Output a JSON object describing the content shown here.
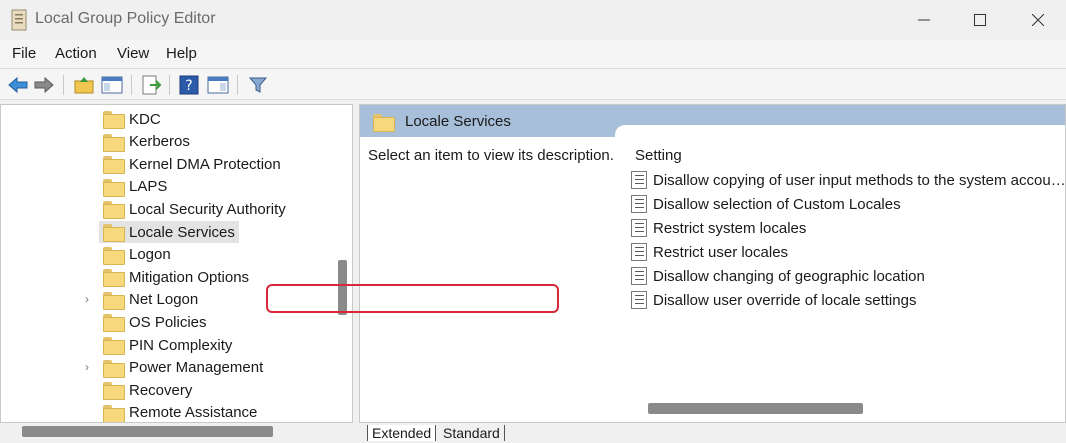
{
  "window": {
    "title": "Local Group Policy Editor",
    "minimize": "—",
    "maximize": "☐",
    "close": "✕"
  },
  "menu": [
    "File",
    "Action",
    "View",
    "Help"
  ],
  "tree": {
    "items": [
      {
        "label": "KDC",
        "expandable": false,
        "selected": false
      },
      {
        "label": "Kerberos",
        "expandable": false,
        "selected": false
      },
      {
        "label": "Kernel DMA Protection",
        "expandable": false,
        "selected": false
      },
      {
        "label": "LAPS",
        "expandable": false,
        "selected": false
      },
      {
        "label": "Local Security Authority",
        "expandable": false,
        "selected": false
      },
      {
        "label": "Locale Services",
        "expandable": false,
        "selected": true
      },
      {
        "label": "Logon",
        "expandable": false,
        "selected": false
      },
      {
        "label": "Mitigation Options",
        "expandable": false,
        "selected": false
      },
      {
        "label": "Net Logon",
        "expandable": true,
        "selected": false
      },
      {
        "label": "OS Policies",
        "expandable": false,
        "selected": false
      },
      {
        "label": "PIN Complexity",
        "expandable": false,
        "selected": false
      },
      {
        "label": "Power Management",
        "expandable": true,
        "selected": false
      },
      {
        "label": "Recovery",
        "expandable": false,
        "selected": false
      },
      {
        "label": "Remote Assistance",
        "expandable": false,
        "selected": false
      }
    ]
  },
  "details": {
    "header_title": "Locale Services",
    "description": "Select an item to view its description.",
    "column_header": "Setting",
    "settings": [
      "Disallow copying of user input methods to the system accou…",
      "Disallow selection of Custom Locales",
      "Restrict system locales",
      "Restrict user locales",
      "Disallow changing of geographic location",
      "Disallow user override of locale settings"
    ],
    "highlight_color": "#d6293a"
  },
  "tabs": [
    "Extended",
    "Standard"
  ]
}
